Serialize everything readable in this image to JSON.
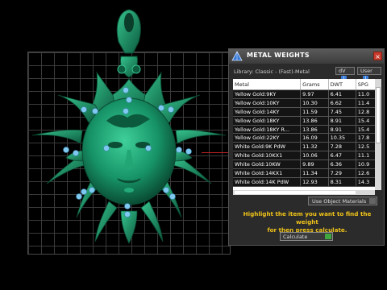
{
  "panel": {
    "title": "METAL WEIGHTS",
    "close_label": "×",
    "library_label": "Library: Classic - (Fast)-Metal",
    "dv_label": "dV",
    "user_label": "User",
    "info_glyph": "i",
    "columns": [
      "Metal",
      "Grams",
      "DWT",
      "SPG"
    ],
    "rows": [
      [
        "Yellow Gold:9KY",
        "9.97",
        "6.41",
        "11.0"
      ],
      [
        "Yellow Gold:10KY",
        "10.30",
        "6.62",
        "11.4"
      ],
      [
        "Yellow Gold:14KY",
        "11.59",
        "7.45",
        "12.8"
      ],
      [
        "Yellow Gold:18KY",
        "13.86",
        "8.91",
        "15.4"
      ],
      [
        "Yellow Gold:18KY R...",
        "13.86",
        "8.91",
        "15.4"
      ],
      [
        "Yellow Gold:22KY",
        "16.09",
        "10.35",
        "17.8"
      ],
      [
        "White Gold:9K PdW",
        "11.32",
        "7.28",
        "12.5"
      ],
      [
        "White Gold:10KX1",
        "10.06",
        "6.47",
        "11.1"
      ],
      [
        "White Gold:10KW",
        "9.89",
        "6.36",
        "10.9"
      ],
      [
        "White Gold:14KX1",
        "11.34",
        "7.29",
        "12.6"
      ],
      [
        "White Gold:14K PdW",
        "12.93",
        "8.31",
        "14.3"
      ]
    ],
    "uom_label": "Use Object Materials",
    "instruction_line1": "Highlight the item you want to find the weight",
    "instruction_line2": "for then press calculate.",
    "calculate_label": "Calculate"
  },
  "colors": {
    "model": "#1a9a70",
    "model_dark": "#0d5c40",
    "gems": "#7fc8f0",
    "accent_text": "#f0c419"
  },
  "icons": {
    "title": "pyramid-tool-icon",
    "close": "close-icon",
    "info": "info-icon"
  }
}
